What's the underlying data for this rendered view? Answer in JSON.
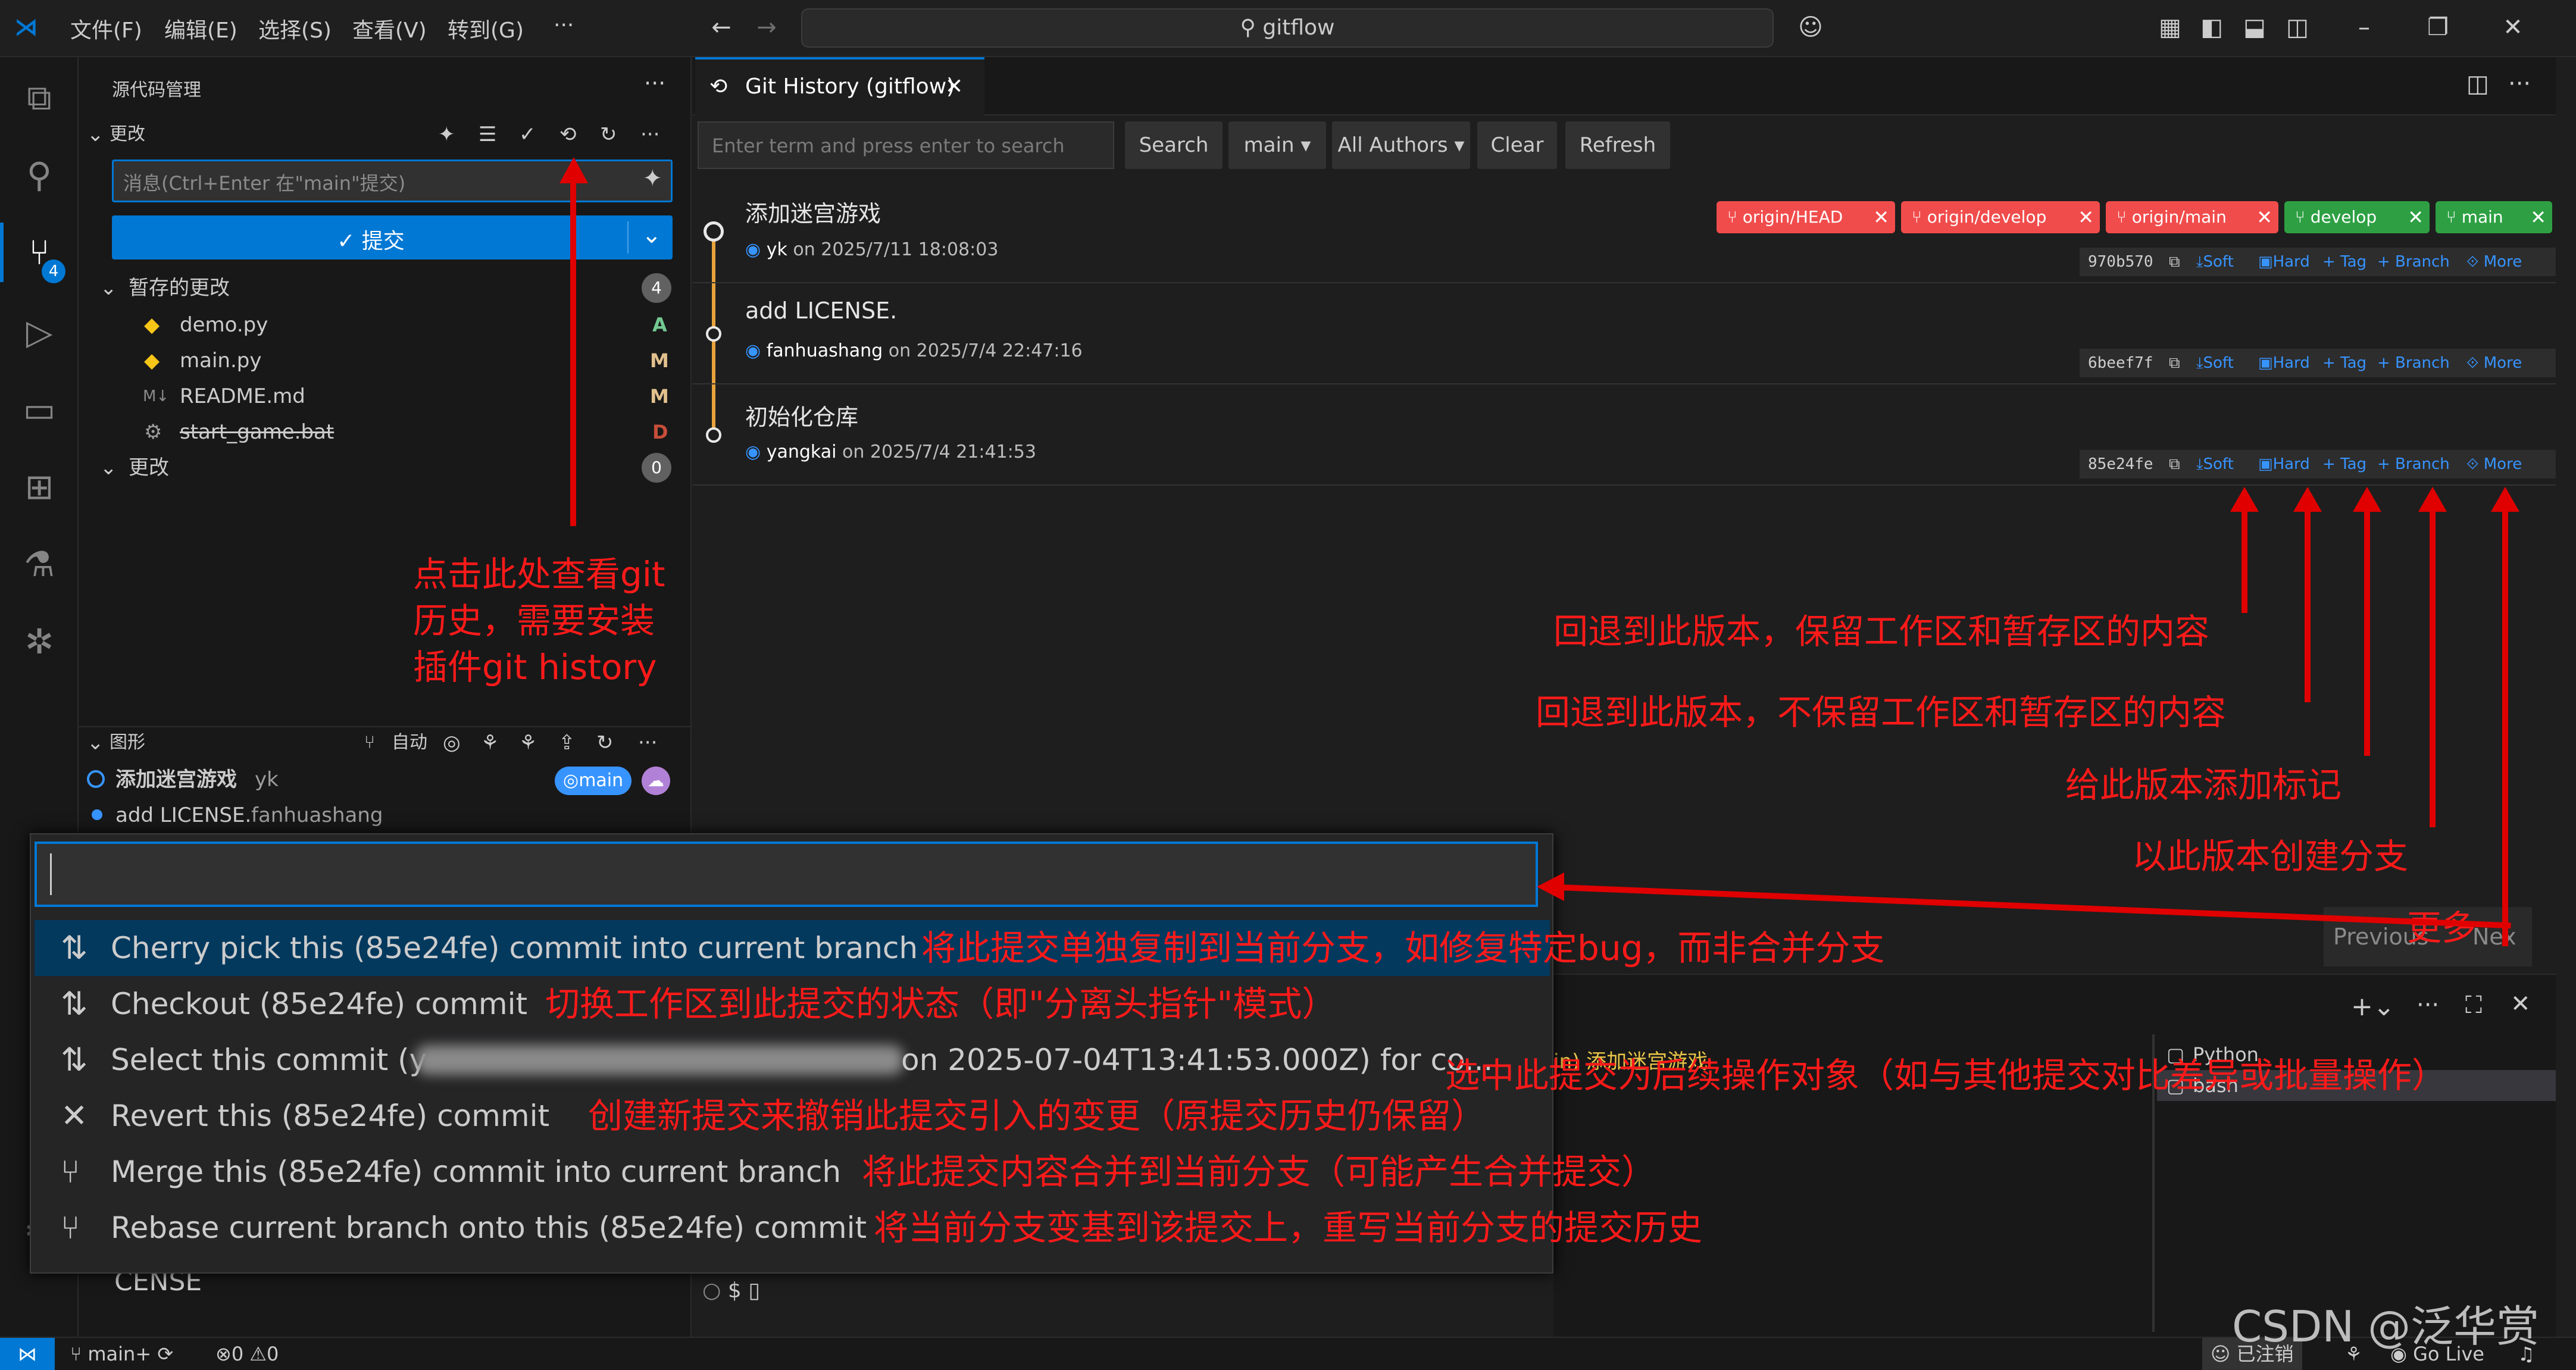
{
  "titlebar": {
    "menus": [
      "文件(F)",
      "编辑(E)",
      "选择(S)",
      "查看(V)",
      "转到(G)",
      "···"
    ],
    "search": "gitflow",
    "nav_back": "←",
    "nav_forward": "→"
  },
  "activity_badge": "4",
  "sidebar": {
    "title": "源代码管理",
    "changes_section": "更改",
    "commit_placeholder": "消息(Ctrl+Enter 在\"main\"提交)",
    "commit_button": "✓ 提交",
    "staged_label": "暂存的更改",
    "staged_count": "4",
    "files": [
      {
        "name": "demo.py",
        "status": "A",
        "icon": "python-file-icon"
      },
      {
        "name": "main.py",
        "status": "M",
        "icon": "python-file-icon"
      },
      {
        "name": "README.md",
        "status": "M",
        "icon": "markdown-file-icon"
      },
      {
        "name": "start_game.bat",
        "status": "D",
        "icon": "gear-file-icon"
      }
    ],
    "unstaged_label": "更改",
    "unstaged_count": "0",
    "graph_label": "图形",
    "graph_auto": "自动",
    "graph_commits": [
      {
        "title": "添加迷宫游戏",
        "author": "yk",
        "ref": "main"
      },
      {
        "title": "add LICENSE.",
        "author": "fanhuashang"
      }
    ],
    "partial_text": "CENSE"
  },
  "editor": {
    "tab_title": "Git History (gitflow)",
    "search_placeholder": "Enter term and press enter to search",
    "buttons": {
      "search": "Search",
      "branch": "main ▾",
      "authors": "All Authors ▾",
      "clear": "Clear",
      "refresh": "Refresh"
    },
    "commits": [
      {
        "title": "添加迷宫游戏",
        "author": "yk",
        "date": "on 2025/7/11 18:08:03",
        "hash": "970b570"
      },
      {
        "title": "add LICENSE.",
        "author": "fanhuashang",
        "date": "on 2025/7/4 22:47:16",
        "hash": "6beef7f"
      },
      {
        "title": "初始化仓库",
        "author": "yangkai",
        "date": "on 2025/7/4 21:41:53",
        "hash": "85e24fe"
      }
    ],
    "refs": [
      {
        "name": "origin/HEAD",
        "color": "#f14c4c"
      },
      {
        "name": "origin/develop",
        "color": "#f14c4c"
      },
      {
        "name": "origin/main",
        "color": "#f14c4c"
      },
      {
        "name": "develop",
        "color": "#2ea043"
      },
      {
        "name": "main",
        "color": "#2ea043"
      }
    ],
    "row_actions": {
      "soft": "Soft",
      "hard": "Hard",
      "tag": "+ Tag",
      "branch": "+ Branch",
      "more": "⟐ More"
    },
    "pager": {
      "previous": "Previous",
      "next": "Nex"
    }
  },
  "annotations": {
    "history_hint": [
      "点击此处查看git",
      "历史，需要安装",
      "插件git history"
    ],
    "soft": "回退到此版本，保留工作区和暂存区的内容",
    "hard": "回退到此版本，不保留工作区和暂存区的内容",
    "tag": "给此版本添加标记",
    "branch": "以此版本创建分支",
    "more": "更多"
  },
  "quickpick": {
    "items": [
      {
        "label": "Cherry pick this (85e24fe) commit into current branch",
        "note": "将此提交单独复制到当前分支，如修复特定bug，而非合并分支",
        "icon": "git-compare-icon"
      },
      {
        "label": "Checkout (85e24fe) commit",
        "note": "切换工作区到此提交的状态（即\"分离头指针\"模式）",
        "icon": "git-compare-icon"
      },
      {
        "label": "Select this commit (y",
        "label_tail": "on 2025-07-04T13:41:53.000Z) for co...",
        "note": "选中此提交为后续操作对象（如与其他提交对比差异或批量操作）",
        "icon": "git-compare-icon"
      },
      {
        "label": "Revert this (85e24fe) commit",
        "note": "创建新提交来撤销此提交引入的变更（原提交历史仍保留）",
        "icon": "close-icon"
      },
      {
        "label": "Merge this (85e24fe) commit into current branch",
        "note": "将此提交内容合并到当前分支（可能产生合并提交）",
        "icon": "git-merge-icon"
      },
      {
        "label": "Rebase current branch onto this (85e24fe) commit",
        "note": "将当前分支变基到该提交上，重写当前分支的提交历史",
        "icon": "git-merge-icon"
      }
    ]
  },
  "panel": {
    "terminal_line": "in) 添加迷宫游戏",
    "prompt": "$",
    "terminals": [
      "Python",
      "bash"
    ]
  },
  "statusbar": {
    "branch": "main+",
    "errors": "0",
    "warnings": "0",
    "right": "已注销",
    "golive": "Go Live"
  },
  "watermark": "CSDN @泛华赏"
}
